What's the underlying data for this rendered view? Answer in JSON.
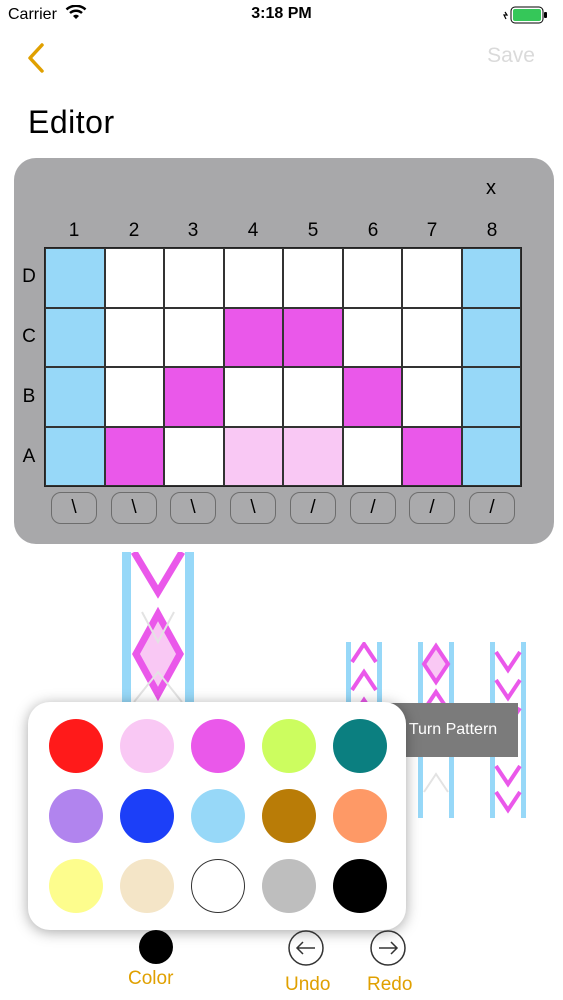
{
  "status": {
    "carrier": "Carrier",
    "time": "3:18 PM"
  },
  "nav": {
    "save": "Save",
    "title": "Editor"
  },
  "editor": {
    "close": "x",
    "columns": [
      "1",
      "2",
      "3",
      "4",
      "5",
      "6",
      "7",
      "8"
    ],
    "rows": [
      "D",
      "C",
      "B",
      "A"
    ],
    "cells": [
      [
        "blue",
        "white",
        "white",
        "white",
        "white",
        "white",
        "white",
        "blue"
      ],
      [
        "blue",
        "white",
        "white",
        "magenta",
        "magenta",
        "white",
        "white",
        "blue"
      ],
      [
        "blue",
        "white",
        "magenta",
        "white",
        "white",
        "magenta",
        "white",
        "blue"
      ],
      [
        "blue",
        "magenta",
        "white",
        "pink",
        "pink",
        "white",
        "magenta",
        "blue"
      ]
    ],
    "directions": [
      "\\",
      "\\",
      "\\",
      "\\",
      "/",
      "/",
      "/",
      "/"
    ]
  },
  "tooltip": "Turn Pattern",
  "palette": {
    "colors": [
      "#ff1a1a",
      "#f9c8f4",
      "#ea58ea",
      "#ccfd5f",
      "#0b7f80",
      "#b184ee",
      "#1c3ff8",
      "#97d8f8",
      "#b97c07",
      "#fe9966",
      "#fdfd8d",
      "#f4e5c7",
      "#ffffff",
      "#bebebe",
      "#000000"
    ]
  },
  "cell_colors": {
    "blue": "#97d8f8",
    "white": "#ffffff",
    "magenta": "#ea58ea",
    "pink": "#f9c8f4"
  },
  "toolbar": {
    "color": "Color",
    "undo": "Undo",
    "redo": "Redo"
  }
}
